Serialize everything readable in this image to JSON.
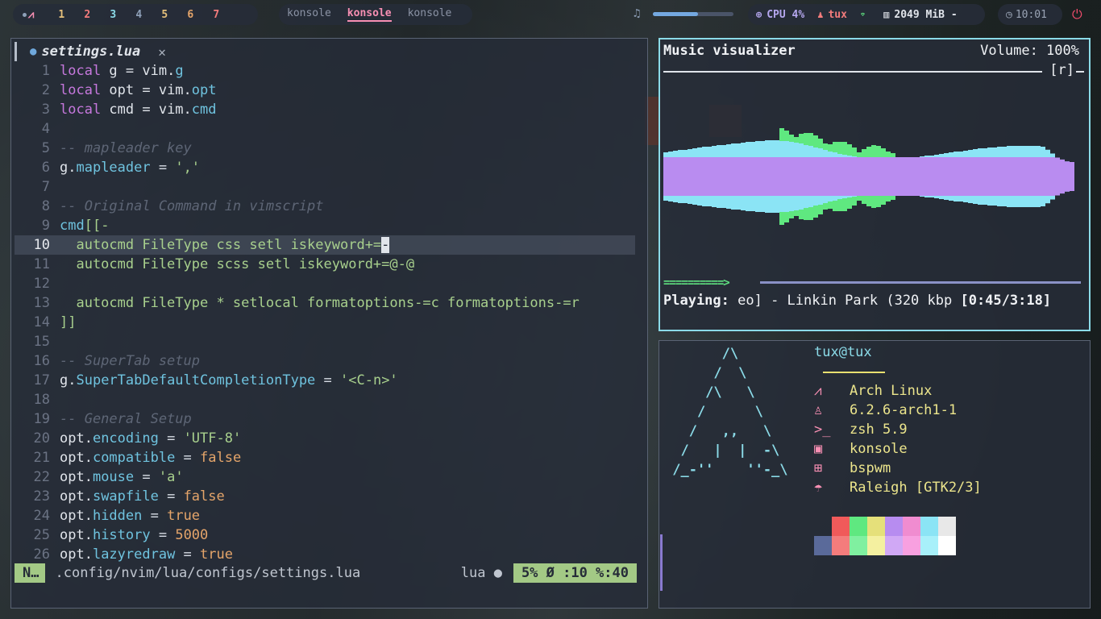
{
  "topbar": {
    "workspace_logo": "⩘",
    "workspaces": [
      {
        "label": "1",
        "color": "#e5c07b"
      },
      {
        "label": "2",
        "color": "#f47c7c"
      },
      {
        "label": "3",
        "color": "#8bdbe8"
      },
      {
        "label": "4",
        "color": "#8ea0b8"
      },
      {
        "label": "5",
        "color": "#e5c07b"
      },
      {
        "label": "6",
        "color": "#e5a56a"
      },
      {
        "label": "7",
        "color": "#f47c7c"
      }
    ],
    "tasks": [
      "konsole",
      "konsole",
      "konsole"
    ],
    "active_task": 1,
    "music_icon": "♫",
    "volume_level": 0.56,
    "cpu_label": "CPU 4%",
    "user_label": "tux",
    "memory_label": "2049 MiB -",
    "clock": "10:01",
    "colors": {
      "cpu": "#b6a8f0",
      "user": "#f47c7c",
      "wifi": "#5fe080",
      "memory": "#e0e4ea"
    }
  },
  "editor": {
    "tab_icon": "●",
    "tab_name": "settings.lua",
    "tab_close": "✕",
    "current_line": 10,
    "statusline": {
      "mode": "N…",
      "path": ".config/nvim/lua/configs/settings.lua",
      "filetype": "lua ●",
      "position": "5% Ø :10 %:40"
    },
    "lines": [
      {
        "n": "1",
        "t": [
          [
            "k",
            "local"
          ],
          [
            "v",
            " g = vim."
          ],
          [
            "f",
            "g"
          ]
        ]
      },
      {
        "n": "2",
        "t": [
          [
            "k",
            "local"
          ],
          [
            "v",
            " opt = vim."
          ],
          [
            "f",
            "opt"
          ]
        ]
      },
      {
        "n": "3",
        "t": [
          [
            "k",
            "local"
          ],
          [
            "v",
            " cmd = vim."
          ],
          [
            "f",
            "cmd"
          ]
        ]
      },
      {
        "n": "4",
        "t": []
      },
      {
        "n": "5",
        "t": [
          [
            "c",
            "-- mapleader key"
          ]
        ]
      },
      {
        "n": "6",
        "t": [
          [
            "v",
            "g."
          ],
          [
            "f",
            "mapleader"
          ],
          [
            "o",
            " = "
          ],
          [
            "s",
            "','"
          ]
        ]
      },
      {
        "n": "7",
        "t": []
      },
      {
        "n": "8",
        "t": [
          [
            "c",
            "-- Original Command in vimscript"
          ]
        ]
      },
      {
        "n": "9",
        "t": [
          [
            "f",
            "cmd"
          ],
          [
            "s",
            "[[-"
          ]
        ]
      },
      {
        "n": "10",
        "t": [
          [
            "s",
            "  autocmd FileType css setl iskeyword+="
          ],
          [
            "cursor",
            "-"
          ]
        ]
      },
      {
        "n": "11",
        "t": [
          [
            "s",
            "  autocmd FileType scss setl iskeyword+=@-@"
          ]
        ]
      },
      {
        "n": "12",
        "t": []
      },
      {
        "n": "13",
        "t": [
          [
            "s",
            "  autocmd FileType * setlocal formatoptions-=c formatoptions-=r"
          ]
        ]
      },
      {
        "n": "14",
        "t": [
          [
            "s",
            "]]"
          ]
        ]
      },
      {
        "n": "15",
        "t": []
      },
      {
        "n": "16",
        "t": [
          [
            "c",
            "-- SuperTab setup"
          ]
        ]
      },
      {
        "n": "17",
        "t": [
          [
            "v",
            "g."
          ],
          [
            "f",
            "SuperTabDefaultCompletionType"
          ],
          [
            "o",
            " = "
          ],
          [
            "s",
            "'<C-n>'"
          ]
        ]
      },
      {
        "n": "18",
        "t": []
      },
      {
        "n": "19",
        "t": [
          [
            "c",
            "-- General Setup"
          ]
        ]
      },
      {
        "n": "20",
        "t": [
          [
            "v",
            "opt."
          ],
          [
            "f",
            "encoding"
          ],
          [
            "o",
            " = "
          ],
          [
            "s",
            "'UTF-8'"
          ]
        ]
      },
      {
        "n": "21",
        "t": [
          [
            "v",
            "opt."
          ],
          [
            "f",
            "compatible"
          ],
          [
            "o",
            " = "
          ],
          [
            "n",
            "false"
          ]
        ]
      },
      {
        "n": "22",
        "t": [
          [
            "v",
            "opt."
          ],
          [
            "f",
            "mouse"
          ],
          [
            "o",
            " = "
          ],
          [
            "s",
            "'a'"
          ]
        ]
      },
      {
        "n": "23",
        "t": [
          [
            "v",
            "opt."
          ],
          [
            "f",
            "swapfile"
          ],
          [
            "o",
            " = "
          ],
          [
            "n",
            "false"
          ]
        ]
      },
      {
        "n": "24",
        "t": [
          [
            "v",
            "opt."
          ],
          [
            "f",
            "hidden"
          ],
          [
            "o",
            " = "
          ],
          [
            "n",
            "true"
          ]
        ]
      },
      {
        "n": "25",
        "t": [
          [
            "v",
            "opt."
          ],
          [
            "f",
            "history"
          ],
          [
            "o",
            " = "
          ],
          [
            "n",
            "5000"
          ]
        ]
      },
      {
        "n": "26",
        "t": [
          [
            "v",
            "opt."
          ],
          [
            "f",
            "lazyredraw"
          ],
          [
            "o",
            " = "
          ],
          [
            "n",
            "true"
          ]
        ]
      }
    ]
  },
  "visualizer": {
    "title": "Music visualizer",
    "volume": "Volume: 100%",
    "flag": "[r]",
    "progress_filled": "==========>",
    "progress_fraction": 0.23,
    "playing_label": "Playing:",
    "track": " eo] - Linkin Park (320 kbp ",
    "time": "[0:45/3:18]",
    "colors": {
      "core": "#b98cf0",
      "mid": "#8be4f5",
      "peak": "#5fe880"
    }
  },
  "fetch": {
    "user": "tux@tux",
    "ascii": "       /\\\n      /  \\\n     /\\   \\\n    /      \\\n   /   ,,   \\\n  /   |  |  -\\\n /_-''    ''-_\\",
    "info": [
      {
        "icon": "⩘",
        "value": "Arch Linux"
      },
      {
        "icon": "♙",
        "value": "6.2.6-arch1-1"
      },
      {
        "icon": ">_",
        "value": "zsh 5.9"
      },
      {
        "icon": "▣",
        "value": "konsole"
      },
      {
        "icon": "⊞",
        "value": "bspwm"
      },
      {
        "icon": "☂",
        "value": "Raleigh [GTK2/3]"
      }
    ],
    "palette_top": [
      "transparent",
      "#f05a5a",
      "#5fe880",
      "#e5e07a",
      "#b78cf0",
      "#f08cd0",
      "#8be4f5",
      "#e8e8e8"
    ],
    "palette_bottom": [
      "#5a6a9a",
      "#f47c7c",
      "#80f0a0",
      "#f4f0a0",
      "#d0a8f5",
      "#f8a0e0",
      "#a8f0fa",
      "#ffffff"
    ]
  }
}
